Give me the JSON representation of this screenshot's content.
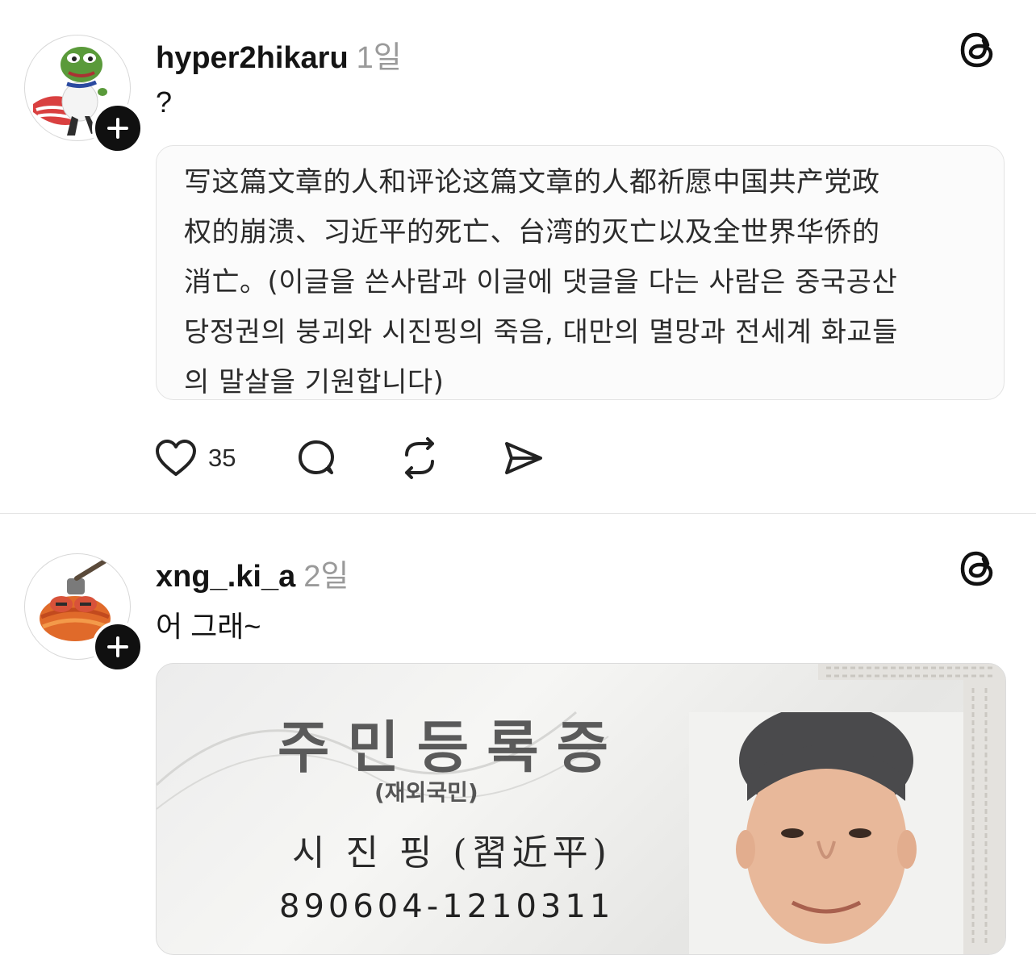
{
  "posts": [
    {
      "username": "hyper2hikaru",
      "time": "1일",
      "caption": "?",
      "quote_lines": [
        "写这篇文章的人和评论这篇文章的人都祈愿中国共产党政",
        "权的崩溃、习近平的死亡、台湾的灭亡以及全世界华侨的",
        "消亡。(이글을 쓴사람과 이글에 댓글을 다는 사람은 중국공산",
        "당정권의 붕괴와 시진핑의 죽음, 대만의 멸망과 전세계 화교들",
        "의 말살을 기원합니다)"
      ],
      "like_count": "35",
      "avatar_icon": "frog-meme-avatar-icon"
    },
    {
      "username": "xng_.ki_a",
      "time": "2일",
      "caption": "어 그래~",
      "avatar_icon": "frog-hammer-avatar-icon",
      "id_card": {
        "title": "주민등록증",
        "subtitle": "(재외국민)",
        "name": "시 진 핑 (習近平)",
        "number": "890604-1210311"
      }
    }
  ],
  "colors": {
    "text": "#141414",
    "muted": "#9a9a9a",
    "divider": "#e4e4e4",
    "follow_button": "#101010"
  }
}
